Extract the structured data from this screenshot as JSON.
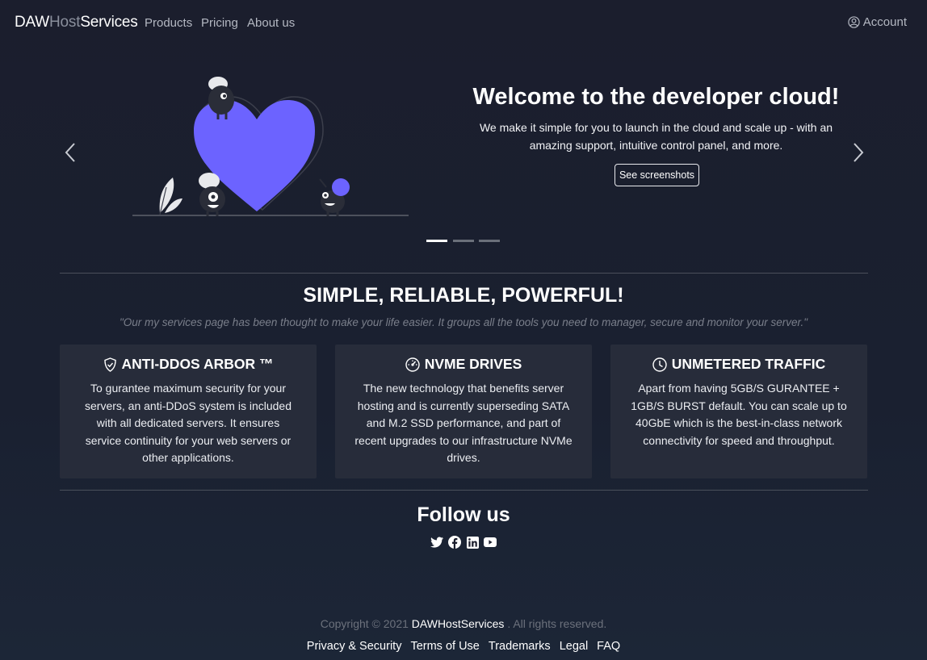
{
  "navbar": {
    "brand": {
      "part1": "DAW",
      "part2": "Host",
      "part3": "Services"
    },
    "links": [
      "Products",
      "Pricing",
      "About us"
    ],
    "account": "Account"
  },
  "hero": {
    "title": "Welcome to the developer cloud!",
    "text": "We make it simple for you to launch in the cloud and scale up - with an amazing support, intuitive control panel, and more.",
    "button": "See screenshots",
    "slides": 3,
    "active_slide": 1
  },
  "features": {
    "title": "SIMPLE, RELIABLE, POWERFUL!",
    "subtitle": "\"Our my services page has been thought to make your life easier. It groups all the tools you need to manager, secure and monitor your server.\"",
    "cards": [
      {
        "icon": "shield-check-icon",
        "title": "ANTI-DDOS ARBOR ™",
        "text": "To gurantee maximum security for your servers, an anti-DDoS system is included with all dedicated servers. It ensures service continuity for your web servers or other applications."
      },
      {
        "icon": "speedometer-icon",
        "title": "NVME DRIVES",
        "text": "The new technology that benefits server hosting and is currently superseding SATA and M.2 SSD performance, and part of recent upgrades to our infrastructure NVMe drives."
      },
      {
        "icon": "clock-icon",
        "title": "UNMETERED TRAFFIC",
        "text": "Apart from having 5GB/S GURANTEE + 1GB/S BURST default. You can scale up to 40GbE which is the best-in-class network connectivity for speed and throughput."
      }
    ]
  },
  "follow": {
    "title": "Follow us",
    "icons": [
      "twitter-icon",
      "facebook-icon",
      "linkedin-icon",
      "youtube-icon"
    ]
  },
  "footer": {
    "copyright_prefix": "Copyright © 2021",
    "brand": "DAWHostServices",
    "copyright_suffix": ". All rights reserved.",
    "links": [
      "Privacy & Security",
      "Terms of Use",
      "Trademarks",
      "Legal",
      "FAQ"
    ]
  },
  "colors": {
    "accent": "#6c63ff",
    "background": "#1b1e2d",
    "card": "#272c3a"
  }
}
